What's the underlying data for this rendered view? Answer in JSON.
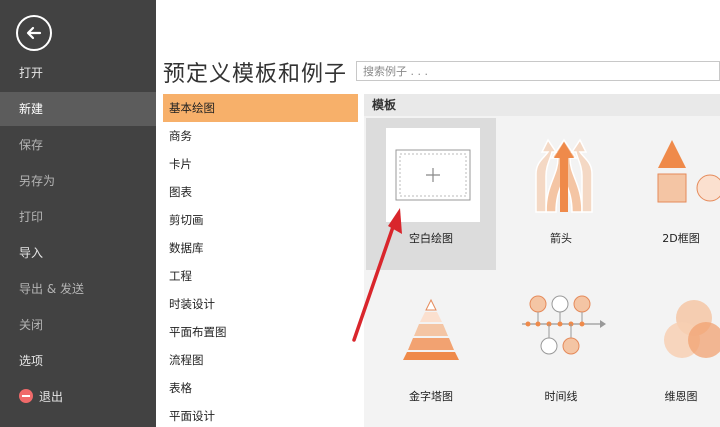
{
  "sidebar": {
    "items": [
      {
        "label": "打开"
      },
      {
        "label": "新建"
      },
      {
        "label": "保存"
      },
      {
        "label": "另存为"
      },
      {
        "label": "打印"
      },
      {
        "label": "导入"
      },
      {
        "label": "导出 & 发送"
      },
      {
        "label": "关闭"
      },
      {
        "label": "选项"
      },
      {
        "label": "退出"
      }
    ]
  },
  "main": {
    "title": "预定义模板和例子",
    "search": {
      "placeholder": "搜索例子 . . ."
    },
    "categories": [
      {
        "label": "基本绘图"
      },
      {
        "label": "商务"
      },
      {
        "label": "卡片"
      },
      {
        "label": "图表"
      },
      {
        "label": "剪切画"
      },
      {
        "label": "数据库"
      },
      {
        "label": "工程"
      },
      {
        "label": "时装设计"
      },
      {
        "label": "平面布置图"
      },
      {
        "label": "流程图"
      },
      {
        "label": "表格"
      },
      {
        "label": "平面设计"
      }
    ],
    "templates_header": "模板",
    "templates": [
      {
        "label": "空白绘图",
        "icon": "blank-canvas-icon"
      },
      {
        "label": "箭头",
        "icon": "arrows-icon"
      },
      {
        "label": "2D框图",
        "icon": "2d-shapes-icon"
      },
      {
        "label": "金字塔图",
        "icon": "pyramid-icon"
      },
      {
        "label": "时间线",
        "icon": "timeline-icon"
      },
      {
        "label": "维恩图",
        "icon": "venn-icon"
      }
    ]
  },
  "colors": {
    "sidebar_bg": "#424242",
    "selected_category": "#f7b06a",
    "accent_orange": "#f29b5c",
    "annotation_arrow": "#d9262c"
  }
}
